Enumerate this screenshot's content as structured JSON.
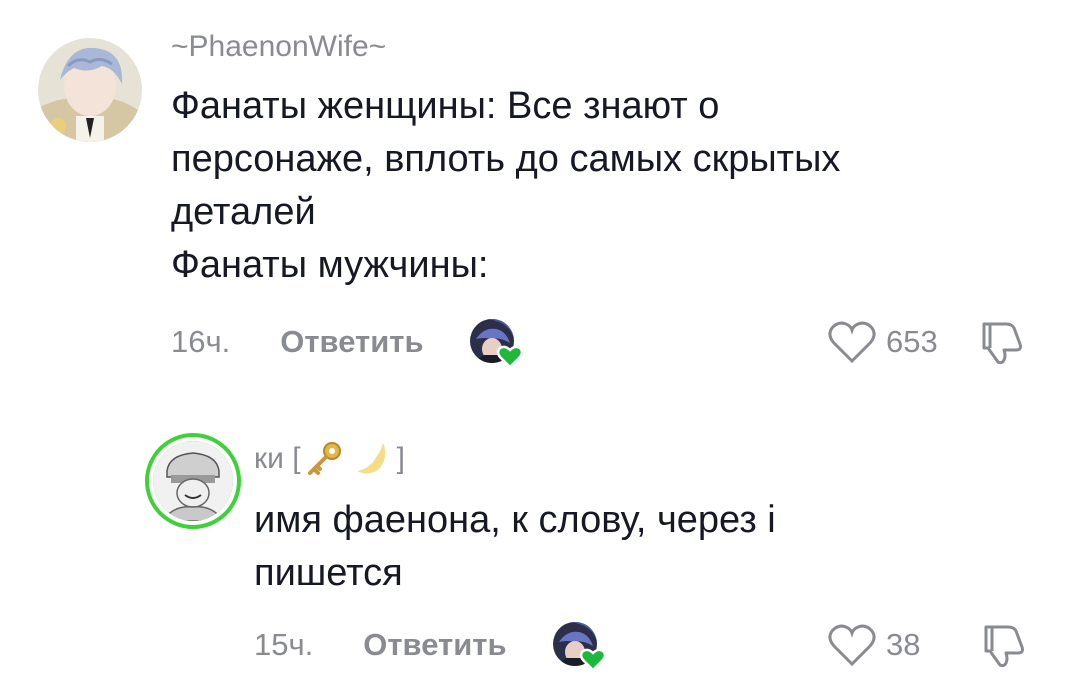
{
  "comments": [
    {
      "username": "~PhaenonWife~",
      "text_lines": [
        "Фанаты женщины: Все знают о",
        "персонаже, вплоть до самых скрытых",
        "деталей",
        "Фанаты мужчины:"
      ],
      "time": "16ч.",
      "reply_label": "Ответить",
      "like_count": "653"
    },
    {
      "username": "ки [",
      "username_suffix": "]",
      "username_emojis": [
        "key-emoji",
        "crescent-moon-emoji"
      ],
      "text_lines": [
        "имя фаенона, к слову, через і",
        "пишется"
      ],
      "time": "15ч.",
      "reply_label": "Ответить",
      "like_count": "38"
    }
  ],
  "icons": {
    "like": "heart-outline-icon",
    "dislike": "thumbs-down-icon",
    "creator_liked_badge": "green-heart-icon"
  },
  "colors": {
    "text": "#161823",
    "muted": "#8a8b91",
    "creator_heart": "#1fb83c",
    "story_ring": "#3fd13a"
  }
}
